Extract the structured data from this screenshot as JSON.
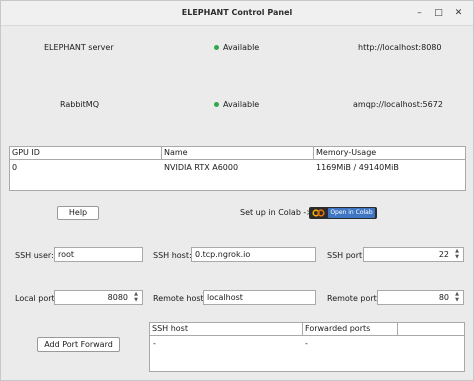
{
  "window": {
    "title": "ELEPHANT Control Panel",
    "min_glyph": "–",
    "max_glyph": "□",
    "close_glyph": "✕"
  },
  "services": [
    {
      "name": "ELEPHANT server",
      "status": "Available",
      "url": "http://localhost:8080",
      "status_color": "#2fa84f"
    },
    {
      "name": "RabbitMQ",
      "status": "Available",
      "url": "amqp://localhost:5672",
      "status_color": "#2fa84f"
    }
  ],
  "gpu_table": {
    "headers": [
      "GPU ID",
      "Name",
      "Memory-Usage"
    ],
    "rows": [
      [
        "0",
        "NVIDIA RTX A6000",
        "1169MiB / 49140MiB"
      ]
    ]
  },
  "help_button": "Help",
  "colab": {
    "prompt": "Set up in Colab ->",
    "badge": "Open in Colab",
    "icon": "colab-logo-icon"
  },
  "ssh": {
    "user_label": "SSH user:",
    "user_value": "root",
    "host_label": "SSH host:",
    "host_value": "0.tcp.ngrok.io",
    "port_label": "SSH port:",
    "port_value": "22"
  },
  "forward": {
    "local_port_label": "Local port:",
    "local_port_value": "8080",
    "remote_host_label": "Remote host:",
    "remote_host_value": "localhost",
    "remote_port_label": "Remote port:",
    "remote_port_value": "80",
    "add_button": "Add Port Forward"
  },
  "forward_table": {
    "headers": [
      "SSH host",
      "Forwarded ports",
      ""
    ],
    "rows": [
      [
        "-",
        "-"
      ]
    ]
  },
  "spin_up": "▲",
  "spin_down": "▼"
}
